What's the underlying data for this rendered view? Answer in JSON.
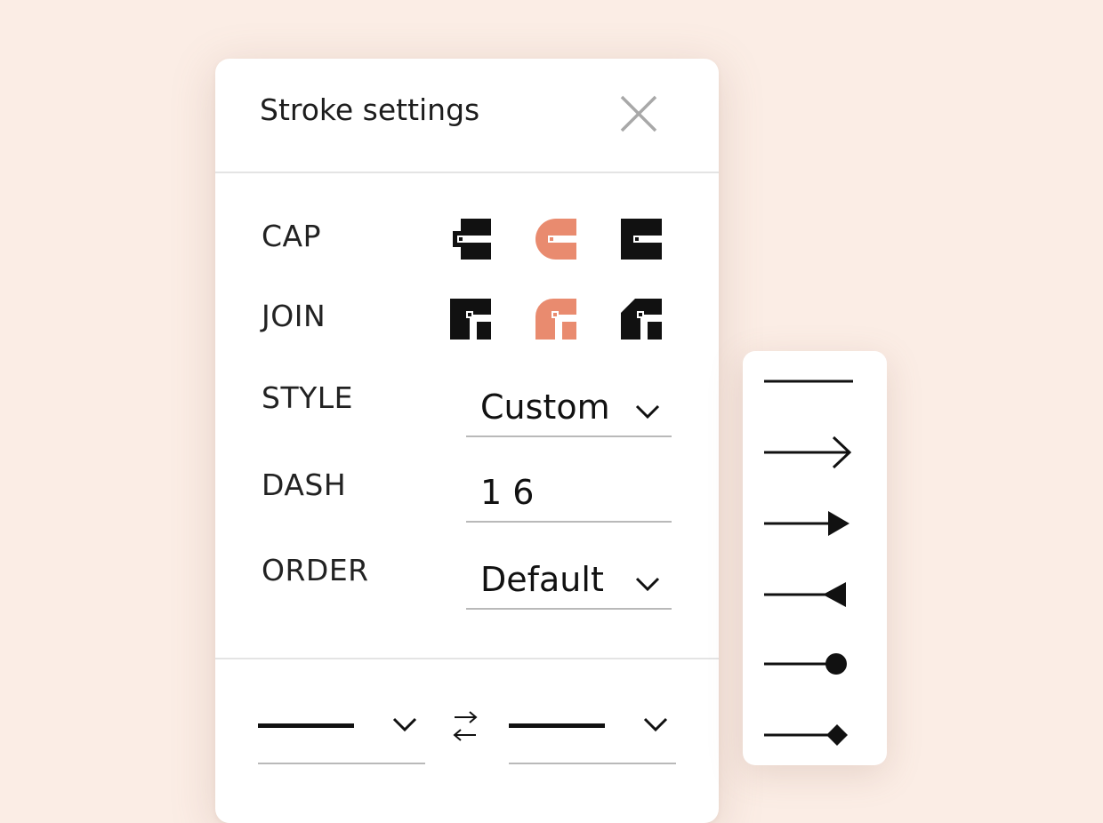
{
  "dialog": {
    "title": "Stroke settings",
    "close_icon": "close-icon"
  },
  "cap": {
    "label": "CAP",
    "options": [
      "butt-cap-icon",
      "round-cap-icon",
      "square-cap-icon"
    ],
    "selected": "round-cap-icon"
  },
  "join": {
    "label": "JOIN",
    "options": [
      "miter-join-icon",
      "round-join-icon",
      "bevel-join-icon"
    ],
    "selected": "round-join-icon"
  },
  "style": {
    "label": "STYLE",
    "value": "Custom"
  },
  "dash": {
    "label": "DASH",
    "value": "1 6"
  },
  "order": {
    "label": "ORDER",
    "value": "Default"
  },
  "line_ends": {
    "start_icon": "plain-line-icon",
    "swap_icon": "swap-arrows-icon",
    "end_icon": "plain-line-icon"
  },
  "end_menu": {
    "items": [
      "none-end-icon",
      "open-arrow-end-icon",
      "filled-arrow-end-icon",
      "reverse-triangle-end-icon",
      "circle-end-icon",
      "diamond-end-icon"
    ]
  },
  "colors": {
    "accent": "#e98b6f",
    "background": "#fbede5",
    "ink": "#111111"
  }
}
